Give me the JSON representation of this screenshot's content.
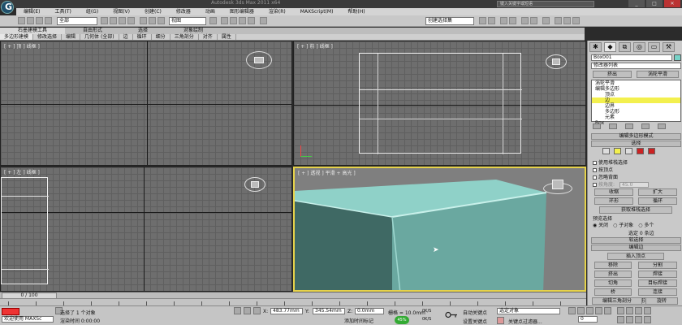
{
  "title": {
    "text": "Autodesk 3ds Max 2011 x64",
    "search_placeholder": "键入关键字或短语"
  },
  "menu": [
    "编辑(E)",
    "工具(T)",
    "组(G)",
    "视图(V)",
    "创建(C)",
    "修改器",
    "动画",
    "图形编辑器",
    "渲染(R)",
    "MAXScript(M)",
    "帮助(H)"
  ],
  "toolbar": {
    "filter_select": "全部",
    "view_select": "视图",
    "named_sel": "创建选择集"
  },
  "ribbon": {
    "tabs": [
      "石墨建模工具",
      "自由形式",
      "选择",
      "对象绘制"
    ],
    "sub": [
      "多边形建模",
      "修改选择",
      "编辑",
      "几何体 (全部)",
      "边",
      "循环",
      "细分",
      "三角剖分",
      "对齐",
      "属性"
    ]
  },
  "viewports": {
    "top": "[ + ] 顶 ] 线框 ]",
    "front": "[ + ] 前 ] 线框 ]",
    "left": "[ + ] 左 ] 线框 ]",
    "persp": "[ + ] 透视 ] 平滑 + 高光 ]",
    "box_color": "#7cc6bd"
  },
  "cmdpanel": {
    "object_name": "Box001",
    "object_color": "#77d3c8",
    "modifier_list": "修改器列表",
    "btn_extrude_top": "挤出",
    "btn_turbosmooth": "涡轮平滑",
    "stack": [
      "涡轮平滑",
      "编辑多边形",
      "顶点",
      "边",
      "边界",
      "多边形",
      "元素",
      "Box"
    ],
    "rollout_edit_poly_mode": "编辑多边形模式",
    "rollout_selection": "选择",
    "cb_use_stack": "使用堆栈选择",
    "cb_by_vertex": "按顶点",
    "cb_ignore_back": "忽略背面",
    "cb_angle": "按角度:",
    "angle_value": "45.0",
    "btn_shrink": "收缩",
    "btn_grow": "扩大",
    "btn_ring": "环形",
    "btn_loop": "循环",
    "btn_get_stack": "获取堆栈选择",
    "preview_label": "预览选择",
    "radio_off": "关闭",
    "radio_sub": "子对象",
    "radio_multi": "多个",
    "selected_count": "选定 0 条边",
    "rollout_soft": "软选择",
    "rollout_edit_edges": "编辑边",
    "btn_insert_vertex": "插入顶点",
    "btn_remove": "移除",
    "btn_split": "分割",
    "btn_extrude": "挤出",
    "btn_weld": "焊接",
    "btn_chamfer": "切角",
    "btn_target_weld": "目标焊接",
    "btn_bridge": "桥",
    "btn_connect": "连接",
    "btn_create_shape": "创建图形",
    "btn_edit_tri": "编辑三角剖分",
    "btn_rotate": "旋转"
  },
  "timeline": {
    "frame": "0 / 100",
    "ticks": [
      "0",
      "5",
      "10",
      "15",
      "20",
      "25",
      "30",
      "35",
      "40",
      "45",
      "50",
      "55",
      "60",
      "65",
      "70",
      "75",
      "80",
      "85",
      "90",
      "95",
      "100"
    ]
  },
  "status": {
    "welcome": "欢迎使用 MAXSc",
    "selected": "选择了 1 个对象",
    "render_time": "渲染时间 0:00:00",
    "x_val": "483.77mm",
    "y_val": "345.54mm",
    "z_val": "0.0mm",
    "grid": "栅格 = 10.0mm",
    "add_time_tag": "添加时间标记",
    "auto_key": "自动关键点",
    "set_key": "设置关键点",
    "selected_obj": "选定对象",
    "key_filter": "关键点过滤器...",
    "frame_field": "0",
    "net_up": "0K/S",
    "net_down": "0K/S",
    "percent": "45%"
  }
}
